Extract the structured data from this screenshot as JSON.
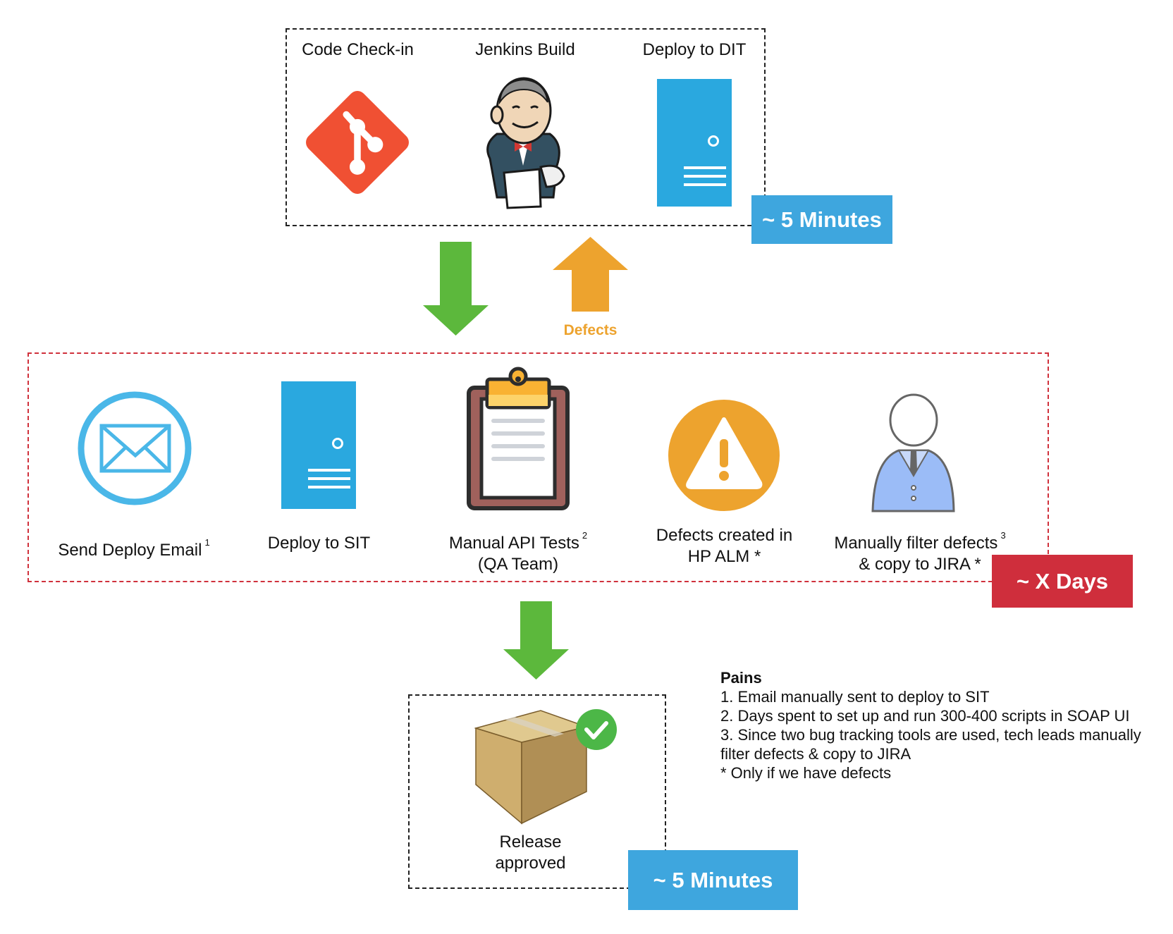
{
  "stage_dev": {
    "steps": [
      {
        "label": "Code Check-in",
        "icon": "git-icon"
      },
      {
        "label": "Jenkins Build",
        "icon": "jenkins-icon"
      },
      {
        "label": "Deploy to DIT",
        "icon": "server-icon"
      }
    ],
    "duration": "~ 5 Minutes"
  },
  "feedback_label": "Defects",
  "stage_sit": {
    "steps": [
      {
        "label": "Send Deploy Email",
        "note": "1",
        "icon": "email-icon"
      },
      {
        "label": "Deploy to SIT",
        "icon": "server-icon"
      },
      {
        "label": "Manual API Tests",
        "note": "2",
        "label2": "(QA Team)",
        "icon": "clipboard-icon"
      },
      {
        "label": "Defects created in",
        "label2": "HP ALM *",
        "icon": "warning-icon"
      },
      {
        "label": "Manually filter defects",
        "note": "3",
        "label2": "& copy to JIRA *",
        "icon": "person-icon"
      }
    ],
    "duration": "~ X Days"
  },
  "stage_release": {
    "label": "Release",
    "label2": "approved",
    "icon": "package-approved-icon",
    "duration": "~ 5 Minutes"
  },
  "pains": {
    "title": "Pains",
    "lines": [
      "1. Email manually sent to deploy to SIT",
      "2. Days spent to set up and run 300-400 scripts in SOAP UI",
      "3. Since two bug tracking tools are used, tech leads manually",
      "filter defects & copy to JIRA",
      "* Only if we have defects"
    ]
  },
  "colors": {
    "blue_badge": "#3ea6de",
    "red_badge": "#cf2e3c",
    "green_arrow": "#5cb83c",
    "orange_arrow": "#eda32e",
    "server": "#2aa8df"
  }
}
